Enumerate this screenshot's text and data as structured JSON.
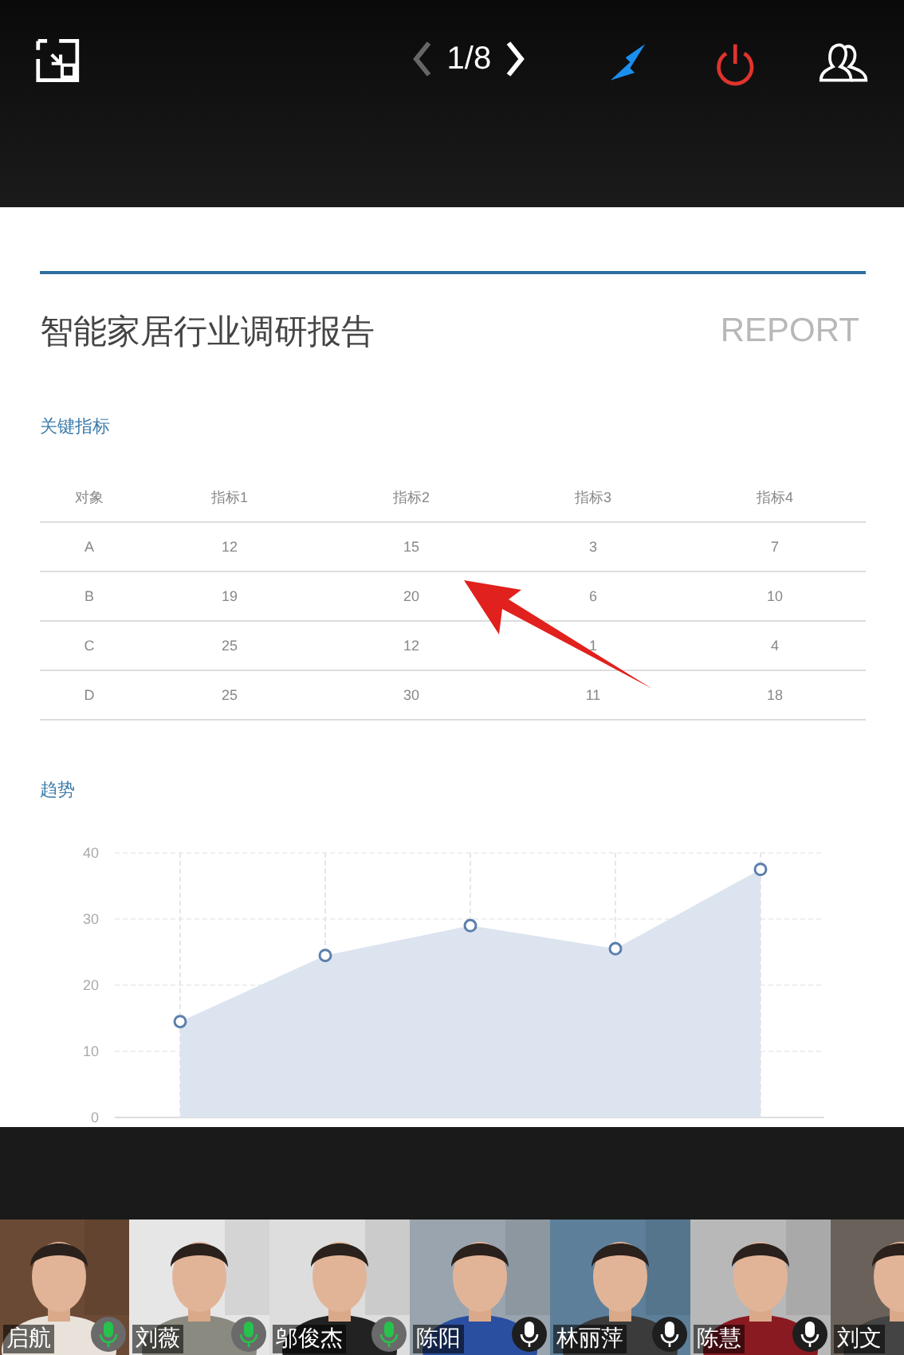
{
  "toolbar": {
    "page": "1/8",
    "prev_disabled": true,
    "next_disabled": false
  },
  "report": {
    "title": "智能家居行业调研报告",
    "watermark": "REPORT",
    "table_heading": "关键指标",
    "columns": [
      "对象",
      "指标1",
      "指标2",
      "指标3",
      "指标4"
    ],
    "rows": [
      [
        "A",
        "12",
        "15",
        "3",
        "7"
      ],
      [
        "B",
        "19",
        "20",
        "6",
        "10"
      ],
      [
        "C",
        "25",
        "12",
        "1",
        "4"
      ],
      [
        "D",
        "25",
        "30",
        "11",
        "18"
      ]
    ],
    "chart_heading": "趋势",
    "chart_data": {
      "type": "area",
      "grid": true,
      "ylim": [
        0,
        40
      ],
      "yticks": [
        0,
        10,
        20,
        30,
        40
      ],
      "values": [
        14.5,
        24.5,
        29,
        25.5,
        37.5
      ]
    }
  },
  "participants": [
    {
      "name": "启航",
      "speaking": true
    },
    {
      "name": "刘薇",
      "speaking": true
    },
    {
      "name": "邬俊杰",
      "speaking": true
    },
    {
      "name": "陈阳",
      "speaking": false
    },
    {
      "name": "林丽萍",
      "speaking": false
    },
    {
      "name": "陈慧",
      "speaking": false
    },
    {
      "name": "刘文"
    }
  ]
}
